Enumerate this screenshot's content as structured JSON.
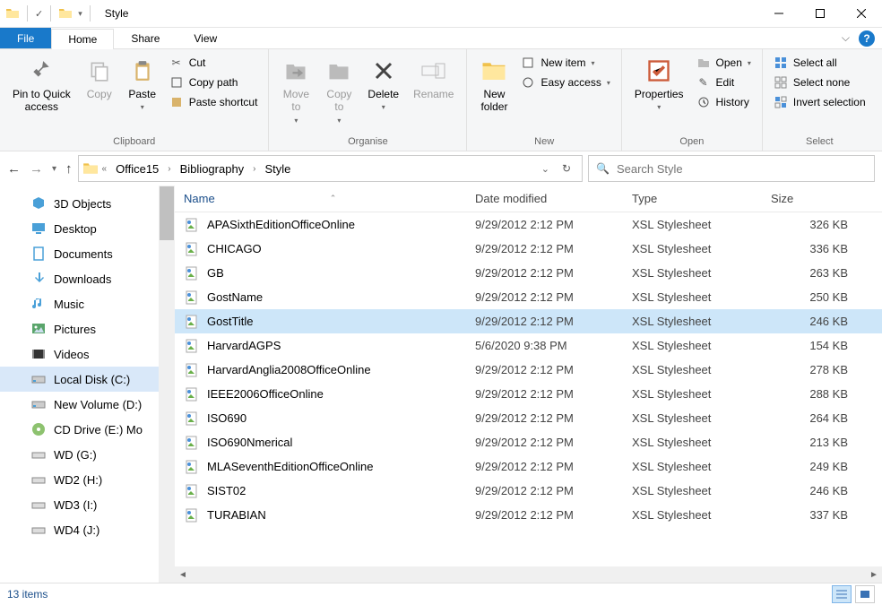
{
  "window": {
    "title": "Style"
  },
  "tabs": {
    "file": "File",
    "home": "Home",
    "share": "Share",
    "view": "View"
  },
  "ribbon": {
    "groups": {
      "clipboard": "Clipboard",
      "organise": "Organise",
      "new": "New",
      "open": "Open",
      "select": "Select"
    },
    "buttons": {
      "pin_quick": "Pin to Quick\naccess",
      "copy": "Copy",
      "paste": "Paste",
      "cut": "Cut",
      "copy_path": "Copy path",
      "paste_shortcut": "Paste shortcut",
      "move_to": "Move\nto",
      "copy_to": "Copy\nto",
      "delete": "Delete",
      "rename": "Rename",
      "new_folder": "New\nfolder",
      "new_item": "New item",
      "easy_access": "Easy access",
      "properties": "Properties",
      "open": "Open",
      "edit": "Edit",
      "history": "History",
      "select_all": "Select all",
      "select_none": "Select none",
      "invert_selection": "Invert selection"
    }
  },
  "breadcrumb": [
    "Office15",
    "Bibliography",
    "Style"
  ],
  "search": {
    "placeholder": "Search Style"
  },
  "sidebar": {
    "items": [
      {
        "label": "3D Objects",
        "icon": "3d"
      },
      {
        "label": "Desktop",
        "icon": "desktop"
      },
      {
        "label": "Documents",
        "icon": "documents"
      },
      {
        "label": "Downloads",
        "icon": "downloads"
      },
      {
        "label": "Music",
        "icon": "music"
      },
      {
        "label": "Pictures",
        "icon": "pictures"
      },
      {
        "label": "Videos",
        "icon": "videos"
      },
      {
        "label": "Local Disk (C:)",
        "icon": "disk",
        "selected": true
      },
      {
        "label": "New Volume (D:)",
        "icon": "disk"
      },
      {
        "label": "CD Drive (E:) Mo",
        "icon": "cd"
      },
      {
        "label": "WD (G:)",
        "icon": "drive"
      },
      {
        "label": "WD2 (H:)",
        "icon": "drive"
      },
      {
        "label": "WD3 (I:)",
        "icon": "drive"
      },
      {
        "label": "WD4 (J:)",
        "icon": "drive"
      }
    ]
  },
  "columns": {
    "name": "Name",
    "date": "Date modified",
    "type": "Type",
    "size": "Size"
  },
  "files": [
    {
      "name": "APASixthEditionOfficeOnline",
      "date": "9/29/2012 2:12 PM",
      "type": "XSL Stylesheet",
      "size": "326 KB"
    },
    {
      "name": "CHICAGO",
      "date": "9/29/2012 2:12 PM",
      "type": "XSL Stylesheet",
      "size": "336 KB"
    },
    {
      "name": "GB",
      "date": "9/29/2012 2:12 PM",
      "type": "XSL Stylesheet",
      "size": "263 KB"
    },
    {
      "name": "GostName",
      "date": "9/29/2012 2:12 PM",
      "type": "XSL Stylesheet",
      "size": "250 KB"
    },
    {
      "name": "GostTitle",
      "date": "9/29/2012 2:12 PM",
      "type": "XSL Stylesheet",
      "size": "246 KB",
      "selected": true
    },
    {
      "name": "HarvardAGPS",
      "date": "5/6/2020 9:38 PM",
      "type": "XSL Stylesheet",
      "size": "154 KB"
    },
    {
      "name": "HarvardAnglia2008OfficeOnline",
      "date": "9/29/2012 2:12 PM",
      "type": "XSL Stylesheet",
      "size": "278 KB"
    },
    {
      "name": "IEEE2006OfficeOnline",
      "date": "9/29/2012 2:12 PM",
      "type": "XSL Stylesheet",
      "size": "288 KB"
    },
    {
      "name": "ISO690",
      "date": "9/29/2012 2:12 PM",
      "type": "XSL Stylesheet",
      "size": "264 KB"
    },
    {
      "name": "ISO690Nmerical",
      "date": "9/29/2012 2:12 PM",
      "type": "XSL Stylesheet",
      "size": "213 KB"
    },
    {
      "name": "MLASeventhEditionOfficeOnline",
      "date": "9/29/2012 2:12 PM",
      "type": "XSL Stylesheet",
      "size": "249 KB"
    },
    {
      "name": "SIST02",
      "date": "9/29/2012 2:12 PM",
      "type": "XSL Stylesheet",
      "size": "246 KB"
    },
    {
      "name": "TURABIAN",
      "date": "9/29/2012 2:12 PM",
      "type": "XSL Stylesheet",
      "size": "337 KB"
    }
  ],
  "status": {
    "count": "13 items"
  }
}
